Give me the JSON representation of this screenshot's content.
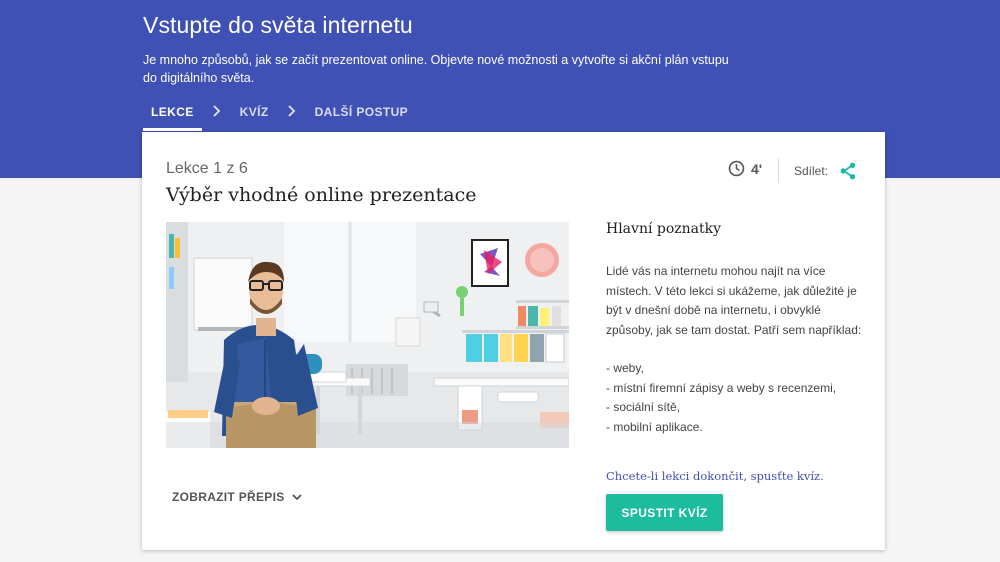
{
  "header": {
    "title": "Vstupte do světa internetu",
    "description": "Je mnoho způsobů, jak se začít prezentovat online. Objevte nové možnosti a vytvořte si akční plán vstupu do digitálního světa.",
    "steps": [
      {
        "label": "LEKCE",
        "active": true
      },
      {
        "label": "KVÍZ",
        "active": false
      },
      {
        "label": "DALŠÍ POSTUP",
        "active": false
      }
    ]
  },
  "lesson": {
    "number_label": "Lekce 1 z 6",
    "title": "Výběr vhodné online prezentace",
    "duration": "4'",
    "share_label": "Sdílet:",
    "transcript_label": "ZOBRAZIT PŘEPIS"
  },
  "takeaways": {
    "title": "Hlavní poznatky",
    "intro": "Lidé vás na internetu mohou najít na více místech. V této lekci si ukážeme, jak důležité je být v dnešní době na internetu, i obvyklé způsoby, jak se tam dostat. Patří sem například:",
    "items": [
      "- weby,",
      "- místní firemní zápisy a weby s recenzemi,",
      "- sociální sítě,",
      "- mobilní aplikace."
    ],
    "cta": "Chcete-li lekci dokončit, spusťte kvíz.",
    "quiz_button": "SPUSTIT KVÍZ"
  },
  "icons": {
    "clock": "clock-icon",
    "share": "share-icon",
    "chevron": "chevron-right-icon",
    "expand": "chevron-down-icon"
  },
  "colors": {
    "header": "#3f51b5",
    "accent": "#1dbc9f"
  }
}
